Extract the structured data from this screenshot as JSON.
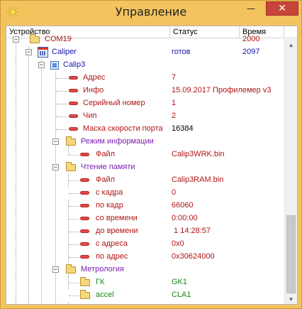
{
  "window": {
    "title": "Управление",
    "minimize": "—",
    "maximize": "☐",
    "close": "✕"
  },
  "columns": {
    "device": "Устройство",
    "status": "Статус",
    "time": "Время"
  },
  "tree": {
    "com": {
      "name": "COM19",
      "time": "2000"
    },
    "caliper": {
      "name": "Caliper",
      "status": "готов",
      "time": "2097"
    },
    "calip": {
      "name": "Calip3"
    },
    "props": [
      {
        "name": "Адрес",
        "value": "7"
      },
      {
        "name": "Инфо",
        "value": "15.09.2017 Профилемер v3"
      },
      {
        "name": "Серийный номер",
        "value": "1"
      },
      {
        "name": "Чип",
        "value": "2"
      },
      {
        "name": "Маска скорости порта",
        "value": "16384"
      }
    ],
    "info_mode": {
      "name": "Режим информации",
      "file_label": "Файл",
      "file_value": "Calip3WRK.bin"
    },
    "memory": {
      "name": "Чтение памяти",
      "items": [
        {
          "name": "Файл",
          "value": "Calip3RAM.bin"
        },
        {
          "name": "с кадра",
          "value": "0"
        },
        {
          "name": "по кадр",
          "value": "66060"
        },
        {
          "name": "со времени",
          "value": "0:00:00"
        },
        {
          "name": "до времени",
          "value": " 1 14:28:57"
        },
        {
          "name": "с адреса",
          "value": "0x0"
        },
        {
          "name": "по адрес",
          "value": "0x30624000"
        }
      ]
    },
    "metrology": {
      "name": "Метрология",
      "items": [
        {
          "name": "ГК",
          "value": "GK1"
        },
        {
          "name": "accel",
          "value": "CLA1"
        }
      ]
    }
  }
}
